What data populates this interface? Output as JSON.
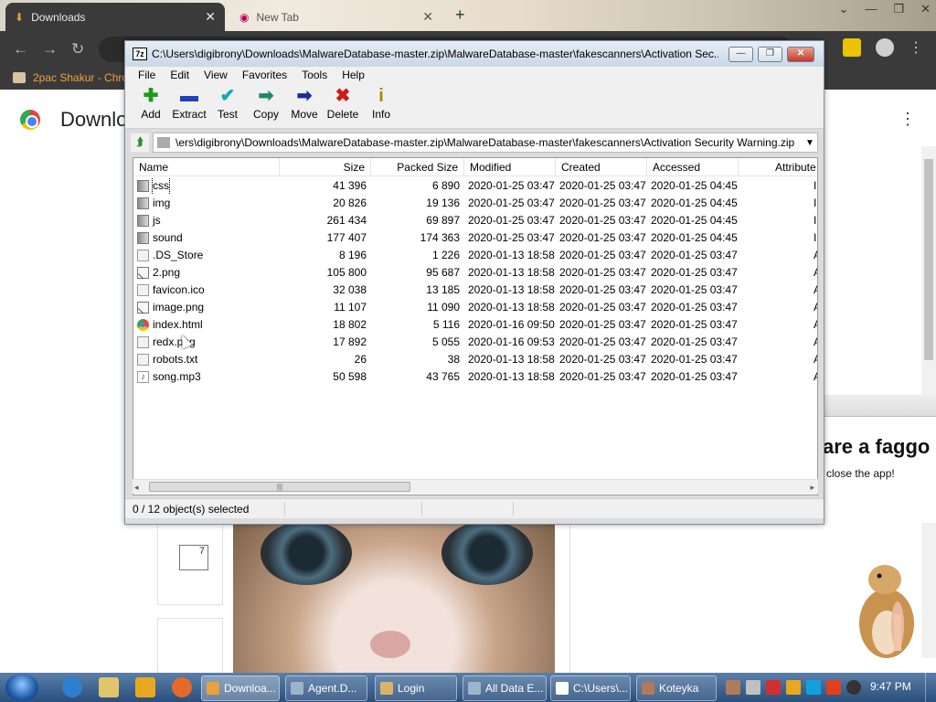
{
  "chrome": {
    "tabs": [
      {
        "label": "Downloads",
        "close": "✕"
      },
      {
        "label": "New Tab",
        "close": "✕"
      }
    ],
    "new_tab": "+",
    "window_controls": [
      "⌄",
      "—",
      "❐",
      "✕"
    ],
    "nav": {
      "back": "←",
      "forward": "→",
      "reload": "↻"
    },
    "bookmark": "2pac Shakur - Chro",
    "page_title": "Downlo",
    "menu": "⋮"
  },
  "zip": {
    "title": "C:\\Users\\digibrony\\Downloads\\MalwareDatabase-master.zip\\MalwareDatabase-master\\fakescanners\\Activation Sec...",
    "logo": "7z",
    "title_buttons": {
      "minimize": "—",
      "maximize": "❐",
      "close": "✕"
    },
    "menu": [
      "File",
      "Edit",
      "View",
      "Favorites",
      "Tools",
      "Help"
    ],
    "toolbar": [
      {
        "label": "Add",
        "icon": "add-icon",
        "glyph": "✚",
        "color": "#1a9c1a"
      },
      {
        "label": "Extract",
        "icon": "extract-icon",
        "glyph": "▬",
        "color": "#2040c0"
      },
      {
        "label": "Test",
        "icon": "test-icon",
        "glyph": "✔",
        "color": "#16a8b0"
      },
      {
        "label": "Copy",
        "icon": "copy-icon",
        "glyph": "➡",
        "color": "#1a8a6a"
      },
      {
        "label": "Move",
        "icon": "move-icon",
        "glyph": "➡",
        "color": "#1a2a9a"
      },
      {
        "label": "Delete",
        "icon": "delete-icon",
        "glyph": "✖",
        "color": "#d01818"
      },
      {
        "label": "Info",
        "icon": "info-icon",
        "glyph": "i",
        "color": "#a08a00"
      }
    ],
    "address": "C:\\Users\\digibrony\\Downloads\\MalwareDatabase-master.zip\\MalwareDatabase-master\\fakescanners\\Activation Security Warning.zip\\",
    "address_visible": "ers\\digibrony\\Downloads\\MalwareDatabase-master.zip\\MalwareDatabase-master\\fakescanners\\Activation Security Warning.zip\\",
    "columns": [
      "Name",
      "Size",
      "Packed Size",
      "Modified",
      "Created",
      "Accessed",
      "Attribute"
    ],
    "rows": [
      {
        "name": "css",
        "type": "folder",
        "size": "41 396",
        "packed": "6 890",
        "modified": "2020-01-25 03:47",
        "created": "2020-01-25 03:47",
        "accessed": "2020-01-25 04:45",
        "attr": "I"
      },
      {
        "name": "img",
        "type": "folder",
        "size": "20 826",
        "packed": "19 136",
        "modified": "2020-01-25 03:47",
        "created": "2020-01-25 03:47",
        "accessed": "2020-01-25 04:45",
        "attr": "I"
      },
      {
        "name": "js",
        "type": "folder",
        "size": "261 434",
        "packed": "69 897",
        "modified": "2020-01-25 03:47",
        "created": "2020-01-25 03:47",
        "accessed": "2020-01-25 04:45",
        "attr": "I"
      },
      {
        "name": "sound",
        "type": "folder",
        "size": "177 407",
        "packed": "174 363",
        "modified": "2020-01-25 03:47",
        "created": "2020-01-25 03:47",
        "accessed": "2020-01-25 04:45",
        "attr": "I"
      },
      {
        "name": ".DS_Store",
        "type": "file",
        "size": "8 196",
        "packed": "1 226",
        "modified": "2020-01-13 18:58",
        "created": "2020-01-25 03:47",
        "accessed": "2020-01-25 03:47",
        "attr": "A"
      },
      {
        "name": "2.png",
        "type": "image",
        "size": "105 800",
        "packed": "95 687",
        "modified": "2020-01-13 18:58",
        "created": "2020-01-25 03:47",
        "accessed": "2020-01-25 03:47",
        "attr": "A"
      },
      {
        "name": "favicon.ico",
        "type": "file",
        "size": "32 038",
        "packed": "13 185",
        "modified": "2020-01-13 18:58",
        "created": "2020-01-25 03:47",
        "accessed": "2020-01-25 03:47",
        "attr": "A"
      },
      {
        "name": "image.png",
        "type": "image",
        "size": "11 107",
        "packed": "11 090",
        "modified": "2020-01-13 18:58",
        "created": "2020-01-25 03:47",
        "accessed": "2020-01-25 03:47",
        "attr": "A"
      },
      {
        "name": "index.html",
        "type": "chrome",
        "size": "18 802",
        "packed": "5 116",
        "modified": "2020-01-16 09:50",
        "created": "2020-01-25 03:47",
        "accessed": "2020-01-25 03:47",
        "attr": "A"
      },
      {
        "name": "redx.png",
        "type": "file",
        "size": "17 892",
        "packed": "5 055",
        "modified": "2020-01-16 09:53",
        "created": "2020-01-25 03:47",
        "accessed": "2020-01-25 03:47",
        "attr": "A"
      },
      {
        "name": "robots.txt",
        "type": "file",
        "size": "26",
        "packed": "38",
        "modified": "2020-01-13 18:58",
        "created": "2020-01-25 03:47",
        "accessed": "2020-01-25 03:47",
        "attr": "A"
      },
      {
        "name": "song.mp3",
        "type": "audio",
        "size": "50 598",
        "packed": "43 765",
        "modified": "2020-01-13 18:58",
        "created": "2020-01-25 03:47",
        "accessed": "2020-01-25 03:47",
        "attr": "A"
      }
    ],
    "scroll": {
      "left": "◂",
      "right": "▸",
      "grip": "|||"
    },
    "status": "0 / 12 object(s) selected"
  },
  "background": {
    "popup_big": "are a faggo",
    "popup_small": "close the app!",
    "calendar": "7"
  },
  "taskbar": {
    "tasks": [
      {
        "label": "Downloa...",
        "icon": "chrome-icon",
        "color": "#e8a33c"
      },
      {
        "label": "Agent.D...",
        "icon": "window-icon",
        "color": "#9bb4cc"
      },
      {
        "label": "Login",
        "icon": "user-icon",
        "color": "#d9b36a"
      },
      {
        "label": "All Data E...",
        "icon": "window-icon",
        "color": "#9bb4cc"
      },
      {
        "label": "C:\\Users\\...",
        "icon": "sevenzip-icon",
        "color": "#ffffff"
      },
      {
        "label": "Koteyka",
        "icon": "cat-icon",
        "color": "#b07b5c"
      }
    ],
    "clock": "9:47 PM"
  }
}
